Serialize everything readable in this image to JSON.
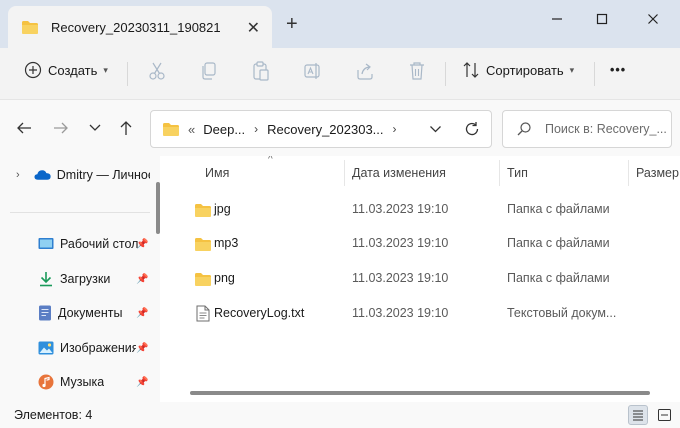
{
  "tab": {
    "title": "Recovery_20230311_190821"
  },
  "toolbar": {
    "create_label": "Создать",
    "sort_label": "Сортировать",
    "more_label": "•••"
  },
  "address": {
    "overflow": "«",
    "crumbs": [
      "Deep...",
      "Recovery_202303..."
    ]
  },
  "search": {
    "placeholder": "Поиск в: Recovery_..."
  },
  "sidebar": {
    "items": [
      {
        "label": "Dmitry — Личное",
        "icon": "onedrive-icon"
      },
      {
        "label": "Рабочий стол",
        "icon": "desktop-icon",
        "pinned": true
      },
      {
        "label": "Загрузки",
        "icon": "download-icon",
        "pinned": true
      },
      {
        "label": "Документы",
        "icon": "documents-icon",
        "pinned": true
      },
      {
        "label": "Изображения",
        "icon": "pictures-icon",
        "pinned": true
      },
      {
        "label": "Музыка",
        "icon": "music-icon",
        "pinned": true
      }
    ]
  },
  "columns": [
    "Имя",
    "Дата изменения",
    "Тип",
    "Размер"
  ],
  "files": [
    {
      "name": "jpg",
      "date": "11.03.2023 19:10",
      "type": "Папка с файлами",
      "icon": "folder-icon"
    },
    {
      "name": "mp3",
      "date": "11.03.2023 19:10",
      "type": "Папка с файлами",
      "icon": "folder-icon"
    },
    {
      "name": "png",
      "date": "11.03.2023 19:10",
      "type": "Папка с файлами",
      "icon": "folder-icon"
    },
    {
      "name": "RecoveryLog.txt",
      "date": "11.03.2023 19:10",
      "type": "Текстовый докум...",
      "icon": "text-file-icon"
    }
  ],
  "status": {
    "text": "Элементов: 4"
  },
  "colors": {
    "titlebar": "#dbe3ee",
    "folder": "#f5c242",
    "accent": "#0067c0"
  }
}
